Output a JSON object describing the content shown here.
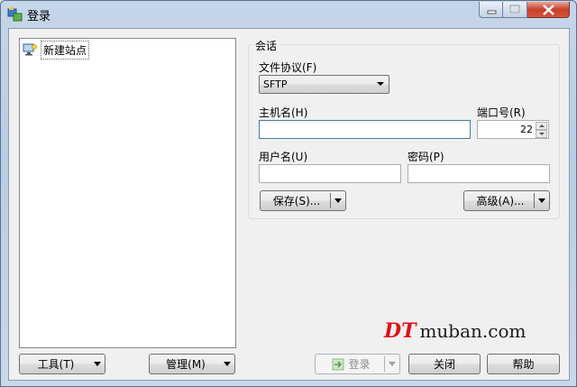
{
  "window": {
    "title": "登录"
  },
  "sites": {
    "items": [
      {
        "label": "新建站点"
      }
    ]
  },
  "session": {
    "group_title": "会话",
    "protocol_label": "文件协议(F)",
    "protocol_value": "SFTP",
    "host_label": "主机名(H)",
    "host_value": "",
    "port_label": "端口号(R)",
    "port_value": "22",
    "user_label": "用户名(U)",
    "user_value": "",
    "password_label": "密码(P)",
    "password_value": "",
    "save_button": "保存(S)...",
    "advanced_button": "高级(A)..."
  },
  "bottom": {
    "tools_button": "工具(T)",
    "manage_button": "管理(M)",
    "login_button": "登录",
    "close_button": "关闭",
    "help_button": "帮助"
  },
  "watermark": {
    "prefix": "DT",
    "rest": "muban.com"
  }
}
